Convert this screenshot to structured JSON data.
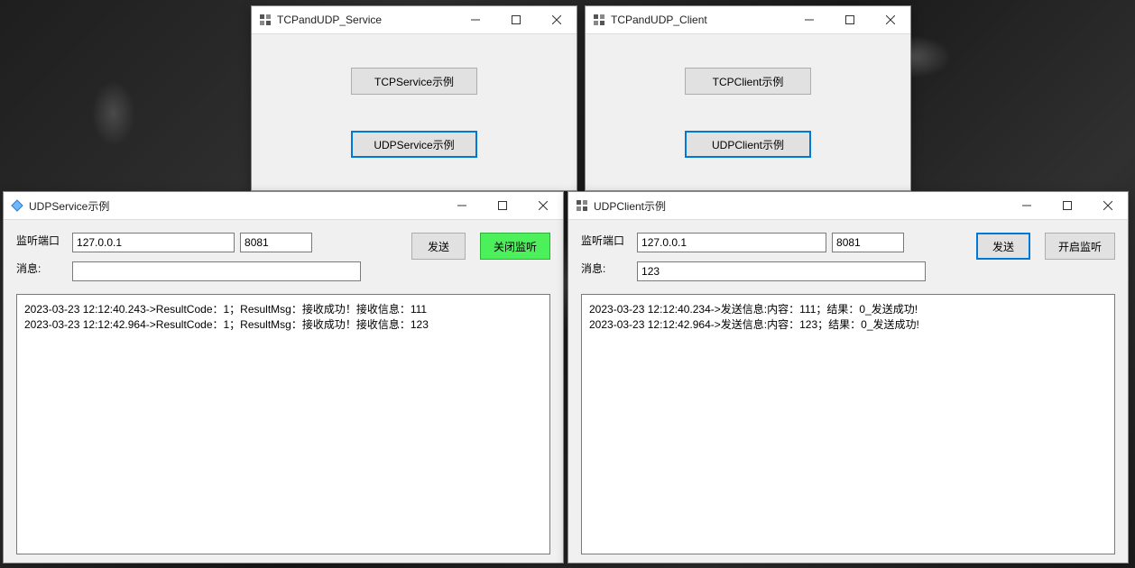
{
  "launcher_service": {
    "title": "TCPandUDP_Service",
    "tcp_button": "TCPService示例",
    "udp_button": "UDPService示例"
  },
  "launcher_client": {
    "title": "TCPandUDP_Client",
    "tcp_button": "TCPClient示例",
    "udp_button": "UDPClient示例"
  },
  "udp_service": {
    "title": "UDPService示例",
    "label_port": "监听端口",
    "label_msg": "消息:",
    "ip": "127.0.0.1",
    "port": "8081",
    "msg": "",
    "send_btn": "发送",
    "listen_btn": "关闭监听",
    "log": [
      "2023-03-23 12:12:40.243->ResultCode：1；ResultMsg：接收成功！接收信息：111",
      "2023-03-23 12:12:42.964->ResultCode：1；ResultMsg：接收成功！接收信息：123"
    ]
  },
  "udp_client": {
    "title": "UDPClient示例",
    "label_port": "监听端口",
    "label_msg": "消息:",
    "ip": "127.0.0.1",
    "port": "8081",
    "msg": "123",
    "send_btn": "发送",
    "listen_btn": "开启监听",
    "log": [
      "2023-03-23 12:12:40.234->发送信息:内容：111；结果：0_发送成功!",
      "2023-03-23 12:12:42.964->发送信息:内容：123；结果：0_发送成功!"
    ]
  },
  "colors": {
    "accent": "#0078d7",
    "listen_active": "#4cf05a"
  }
}
